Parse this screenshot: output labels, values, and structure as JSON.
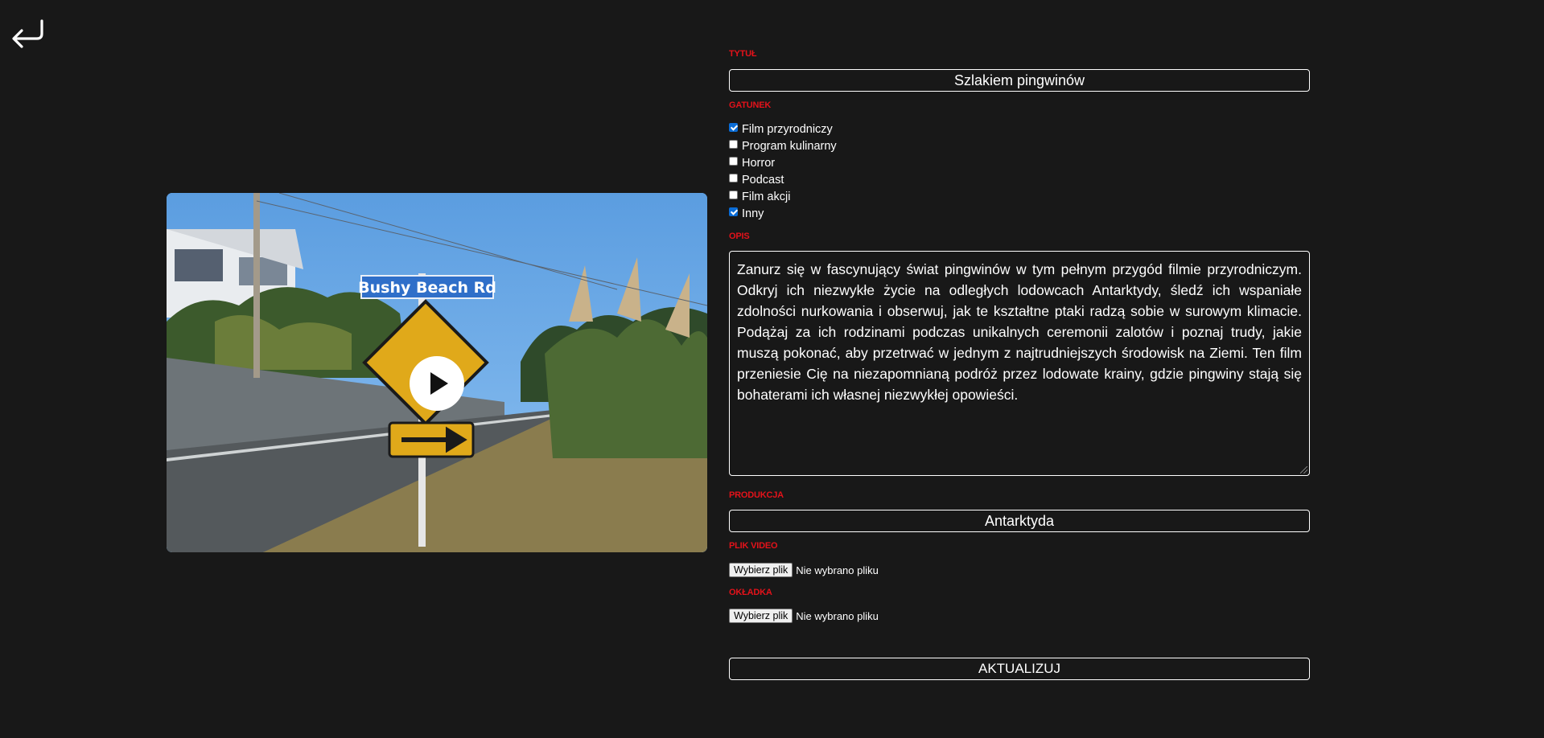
{
  "back": {
    "icon": "return-arrow-icon"
  },
  "preview": {
    "sign_text": "Bushy Beach Rd",
    "play_icon": "play-icon"
  },
  "form": {
    "title_label": "TYTUŁ",
    "title_value": "Szlakiem pingwinów",
    "genre_label": "GATUNEK",
    "genres": [
      {
        "label": "Film przyrodniczy",
        "checked": true
      },
      {
        "label": "Program kulinarny",
        "checked": false
      },
      {
        "label": "Horror",
        "checked": false
      },
      {
        "label": "Podcast",
        "checked": false
      },
      {
        "label": "Film akcji",
        "checked": false
      },
      {
        "label": "Inny",
        "checked": true
      }
    ],
    "description_label": "OPIS",
    "description_value": "Zanurz się w fascynujący świat pingwinów w tym pełnym przygód filmie przyrodniczym. Odkryj ich niezwykłe życie na odległych lodowcach Antarktydy, śledź ich wspaniałe zdolności nurkowania i obserwuj, jak te kształtne ptaki radzą sobie w surowym klimacie. Podążaj za ich rodzinami podczas unikalnych ceremonii zalotów i poznaj trudy, jakie muszą pokonać, aby przetrwać w jednym z najtrudniejszych środowisk na Ziemi. Ten film przeniesie Cię na niezapomnianą podróż przez lodowate krainy, gdzie pingwiny stają się bohaterami ich własnej niezwykłej opowieści.",
    "production_label": "PRODUKCJA",
    "production_value": "Antarktyda",
    "video_label": "PLIK VIDEO",
    "video_button": "Wybierz plik",
    "video_status": "Nie wybrano pliku",
    "cover_label": "OKŁADKA",
    "cover_button": "Wybierz plik",
    "cover_status": "Nie wybrano pliku",
    "submit_label": "AKTUALIZUJ"
  }
}
